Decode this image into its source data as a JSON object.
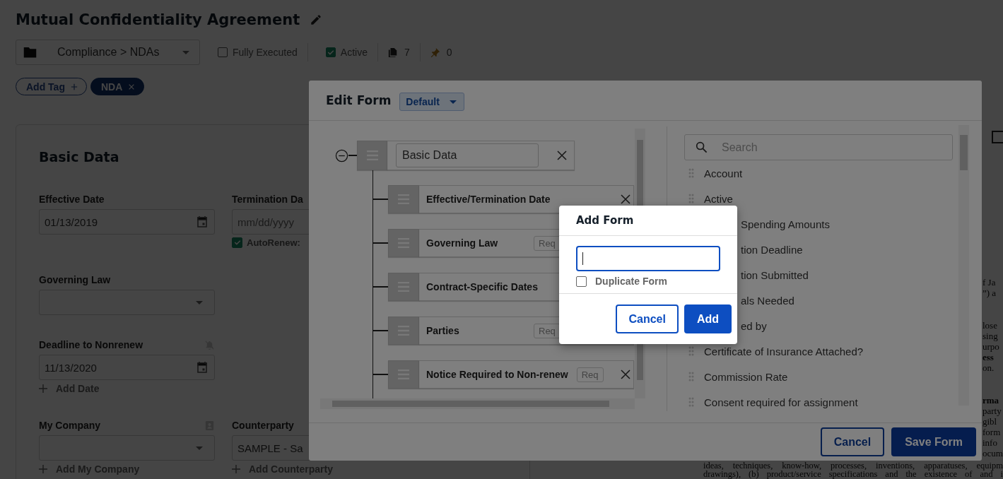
{
  "title": "Mutual Confidentiality Agreement",
  "folder": {
    "path": "Compliance > NDAs"
  },
  "flags": [
    {
      "label": "Fully Executed",
      "checked": false
    },
    {
      "label": "Active",
      "checked": true
    }
  ],
  "counters": [
    {
      "kind": "documents",
      "count": "7"
    },
    {
      "kind": "pins",
      "count": "0"
    }
  ],
  "tags": [
    {
      "label": "Add Tag",
      "kind": "add"
    },
    {
      "label": "NDA",
      "kind": "tag"
    }
  ],
  "basic_data": {
    "title": "Basic Data",
    "rows": [
      {
        "fields": [
          {
            "label": "Effective Date",
            "kind": "date",
            "value": "01/13/2019"
          },
          {
            "label": "Termination Da",
            "kind": "date",
            "placeholder": "mm/dd/yyyy",
            "checkbox": {
              "label": "AutoRenew:",
              "checked": true
            }
          }
        ]
      },
      {
        "fields": [
          {
            "label": "Governing Law",
            "kind": "select"
          }
        ]
      },
      {
        "fields": [
          {
            "label": "Deadline to Nonrenew",
            "kind": "date",
            "value": "11/13/2020",
            "label_icon": {
              "kind": "bell-off"
            },
            "add_link": "Add Date"
          }
        ]
      },
      {
        "fields": [
          {
            "label": "My Company",
            "kind": "select",
            "label_icon": {
              "kind": "contact"
            },
            "add_link": "Add My Company"
          },
          {
            "label": "Counterparty",
            "kind": "text",
            "value": "SAMPLE - Sa",
            "add_link": "Add Counterparty"
          }
        ]
      }
    ]
  },
  "document": {
    "fragments": [
      [
        {
          "text": "f Ja",
          "bold": false
        },
        {
          "text": "”) a",
          "bold": false
        }
      ],
      [
        {
          "text": "lose",
          "bold": false
        },
        {
          "text": "sing",
          "bold": false
        },
        {
          "text": "urpo",
          "bold": false
        },
        {
          "text": "ess",
          "bold": true
        },
        {
          "text": "on.",
          "bold": false
        }
      ],
      [
        {
          "text": "rma",
          "bold": true
        },
        {
          "text": "party",
          "bold": false
        },
        {
          "text": "gibl",
          "bold": false
        },
        {
          "text": "form",
          "bold": false
        },
        {
          "text": "info",
          "bold": false
        },
        {
          "text": "ocum",
          "bold": false
        }
      ]
    ],
    "lines": [
      "ideas, techniques, know-how, processes, inventions, apparatuses, equipm",
      "drawings), (b) product/service specifications and the existence of and i"
    ]
  },
  "edit_form": {
    "title": "Edit Form",
    "form_select": "Default",
    "tree": {
      "label": "Basic Data",
      "expanded": true,
      "children": [
        {
          "label": "Effective/Termination Date"
        },
        {
          "label": "Governing Law",
          "req": "Req"
        },
        {
          "label": "Contract-Specific Dates"
        },
        {
          "label": "Parties",
          "req": "Req"
        },
        {
          "label": "Notice Required to Non-renew",
          "req": "Req"
        }
      ]
    },
    "search": {
      "placeholder": "Search"
    },
    "fields": [
      {
        "label": "Account",
        "kind": "full"
      },
      {
        "label": "Active",
        "kind": "full"
      },
      {
        "label": "Spending Amounts",
        "kind": "partial"
      },
      {
        "label": "tion Deadline",
        "kind": "partial"
      },
      {
        "label": "tion Submitted",
        "kind": "partial"
      },
      {
        "label": "als Needed",
        "kind": "partial"
      },
      {
        "label": "ed by",
        "kind": "partial"
      },
      {
        "label": "Certificate of Insurance Attached?",
        "kind": "full"
      },
      {
        "label": "Commission Rate",
        "kind": "full"
      },
      {
        "label": "Consent required for assignment",
        "kind": "full"
      }
    ],
    "buttons": [
      {
        "label": "Cancel",
        "kind": "secondary"
      },
      {
        "label": "Save Form",
        "kind": "primary"
      }
    ]
  },
  "add_form": {
    "title": "Add Form",
    "focused": true,
    "duplicate": {
      "label": "Duplicate Form",
      "checked": false
    },
    "buttons": [
      {
        "label": "Cancel",
        "kind": "secondary"
      },
      {
        "label": "Add",
        "kind": "primary"
      }
    ]
  }
}
